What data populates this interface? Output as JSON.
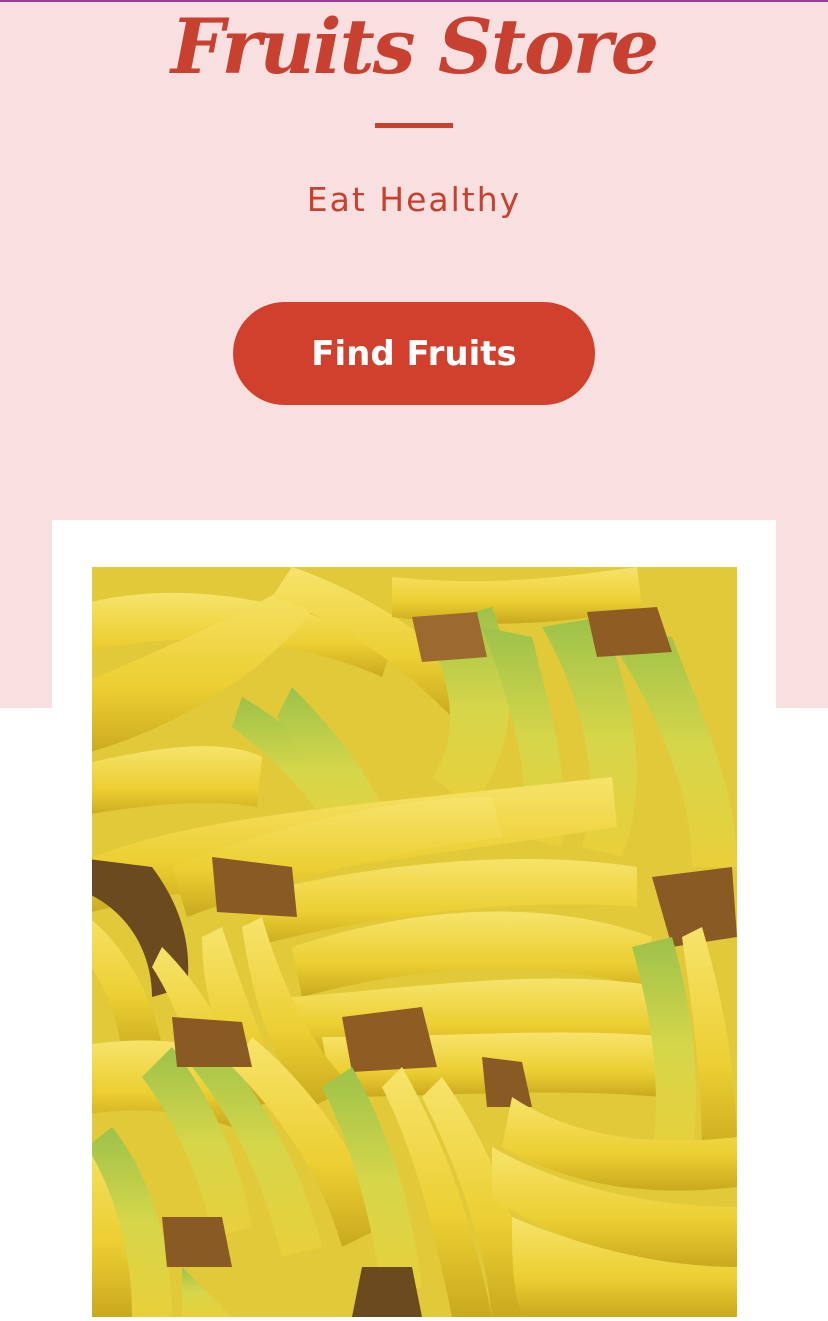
{
  "hero": {
    "title": "Fruits Store",
    "tagline": "Eat Healthy",
    "cta_label": "Find Fruits"
  },
  "colors": {
    "accent": "#c8402f",
    "hero_background": "#f8e0e0",
    "button": "#d0402c",
    "button_text": "#ffffff"
  },
  "featured_image": {
    "subject": "bananas"
  }
}
